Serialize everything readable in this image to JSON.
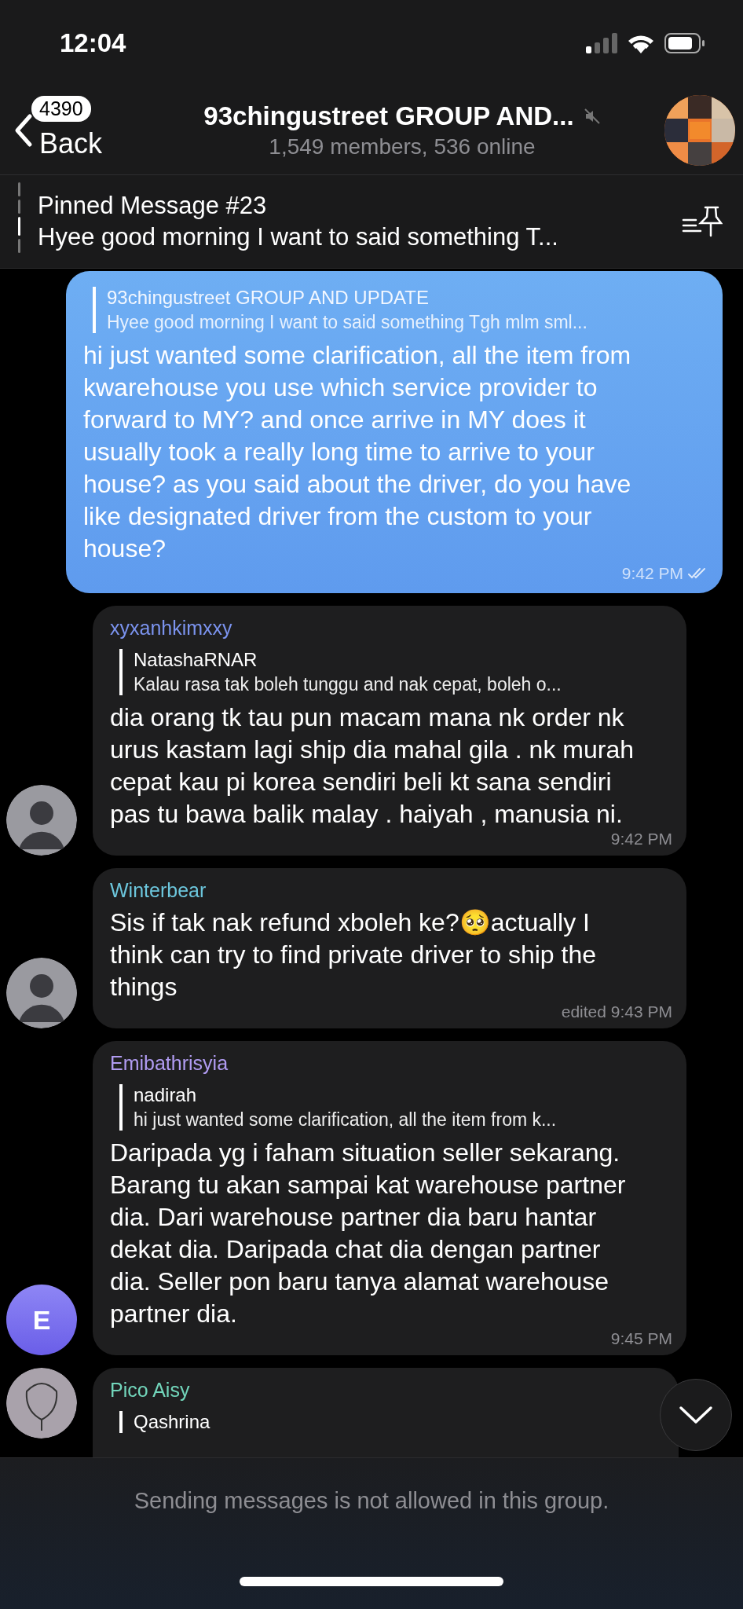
{
  "status_bar": {
    "time": "12:04"
  },
  "header": {
    "unread_count": "4390",
    "back_label": "Back",
    "title": "93chingustreet GROUP AND...",
    "muted": true,
    "subtitle": "1,549 members, 536 online"
  },
  "pinned": {
    "title": "Pinned Message #23",
    "text": "Hyee good morning I want to said something T..."
  },
  "messages": [
    {
      "kind": "outgoing",
      "reply": {
        "name": "93chingustreet GROUP AND UPDATE",
        "text": "Hyee good morning I want to said something Tgh mlm sml..."
      },
      "text": "hi just wanted some clarification, all the item from kwarehouse you use which service provider to forward to MY? and once arrive in MY does it usually took a really long time to arrive to your house? as you said about the driver, do you have like designated driver from the custom to your house?",
      "time": "9:42 PM",
      "read": true
    },
    {
      "kind": "incoming",
      "sender": "xyxanhkimxxy",
      "color": "#7b93ee",
      "reply": {
        "name": "NatashaRNAR",
        "text": "Kalau rasa tak boleh tunggu and nak cepat, boleh o..."
      },
      "text": "dia orang tk tau pun macam mana nk order nk urus kastam lagi ship dia mahal gila . nk murah cepat kau pi korea sendiri beli kt sana sendiri pas tu bawa balik malay . haiyah , manusia ni.",
      "time": "9:42 PM"
    },
    {
      "kind": "incoming",
      "sender": "Winterbear",
      "color": "#6cc6dc",
      "text": "Sis if tak nak refund xboleh ke?🥺actually I think can try to find private driver to ship the things",
      "time": "edited 9:43 PM"
    },
    {
      "kind": "incoming",
      "sender": "Emibathrisyia",
      "color": "#b19cf2",
      "avatar": {
        "kind": "letter",
        "letter": "E"
      },
      "reply": {
        "name": "nadirah",
        "text": "hi just wanted some clarification, all the item from k..."
      },
      "text": "Daripada yg i faham situation seller sekarang. Barang tu akan sampai kat warehouse partner dia. Dari warehouse partner dia baru hantar dekat dia. Daripada chat dia dengan partner dia. Seller pon baru tanya alamat warehouse partner dia.",
      "time": "9:45 PM"
    },
    {
      "kind": "incoming",
      "sender": "Pico Aisy",
      "color": "#72d6bb",
      "avatar": {
        "kind": "sketch"
      },
      "reply": {
        "name": "Qashrina"
      }
    }
  ],
  "footer": {
    "notice": "Sending messages is not allowed in this group."
  }
}
